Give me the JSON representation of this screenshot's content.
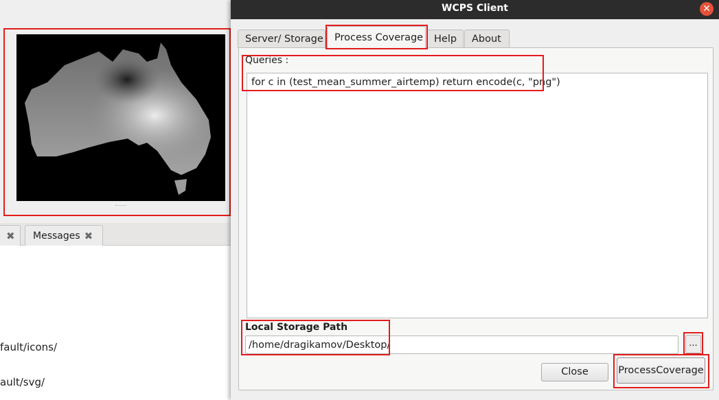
{
  "background_app": {
    "tabs": [
      {
        "label": "",
        "close_icon": "close-x-icon"
      },
      {
        "label": "Messages",
        "close_icon": "close-x-icon"
      }
    ],
    "panel_lines": [
      "fault/icons/",
      "ault/svg/"
    ],
    "map_preview": {
      "description_icon": "coverage-preview-image"
    }
  },
  "dialog": {
    "title": "WCPS Client",
    "close_icon": "window-close-icon",
    "tabs": [
      {
        "label": "Server/ Storage",
        "active": false
      },
      {
        "label": "Process Coverage",
        "active": true
      },
      {
        "label": "Help",
        "active": false
      },
      {
        "label": "About",
        "active": false
      }
    ],
    "queries_label": "Queries :",
    "query_text": "for c in (test_mean_summer_airtemp) return encode(c, \"png\")",
    "storage_label": "Local Storage Path",
    "storage_path": "/home/dragikamov/Desktop/",
    "browse_label": "...",
    "close_label": "Close",
    "process_label": "ProcessCoverage"
  },
  "colors": {
    "titlebar": "#2c2c2c",
    "close_button": "#e5523a",
    "highlight": "#e31b1b"
  }
}
